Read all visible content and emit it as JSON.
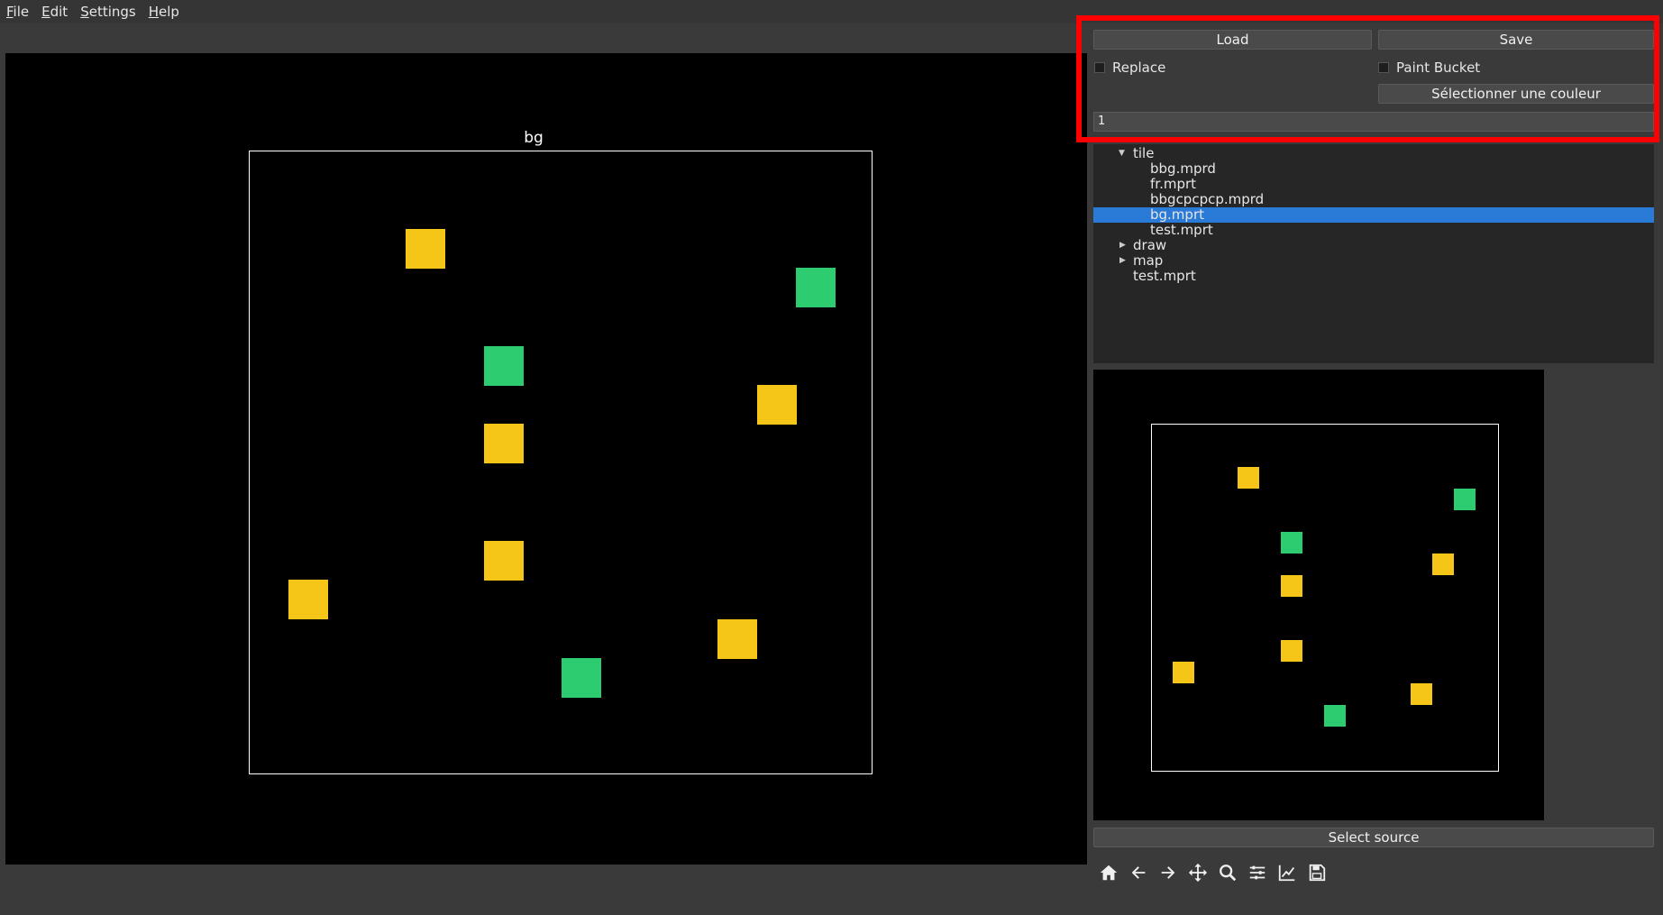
{
  "menu": {
    "items": [
      {
        "ul": "F",
        "rest": "ile"
      },
      {
        "ul": "E",
        "rest": "dit"
      },
      {
        "ul": "S",
        "rest": "ettings"
      },
      {
        "ul": "H",
        "rest": "elp"
      }
    ]
  },
  "canvas": {
    "title": "bg",
    "colors": {
      "yellow": "#f5c518",
      "green": "#2ecc71"
    }
  },
  "controls": {
    "load_label": "Load",
    "save_label": "Save",
    "replace_label": "Replace",
    "paint_bucket_label": "Paint Bucket",
    "select_color_label": "Sélectionner une couleur",
    "value_field": "1",
    "select_source_label": "Select source"
  },
  "tree": {
    "items": [
      {
        "label": "tile",
        "expanded": true
      },
      {
        "label": "bbg.mprd"
      },
      {
        "label": "fr.mprt"
      },
      {
        "label": "bbgcpcpcp.mprd"
      },
      {
        "label": "bg.mprt",
        "selected": true
      },
      {
        "label": "test.mprt"
      },
      {
        "label": "draw",
        "expanded": false
      },
      {
        "label": "map",
        "expanded": false
      },
      {
        "label": "test.mprt"
      }
    ]
  },
  "toolbar": {
    "icons": [
      "home-icon",
      "back-arrow-icon",
      "forward-arrow-icon",
      "pan-icon",
      "zoom-icon",
      "configure-subplots-icon",
      "edit-axis-icon",
      "save-figure-icon"
    ]
  }
}
